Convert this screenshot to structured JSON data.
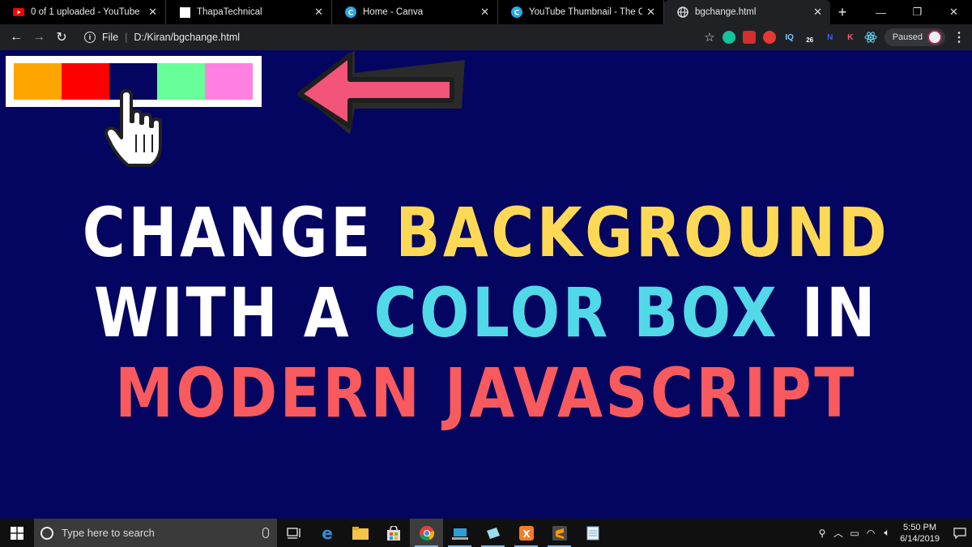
{
  "tabs": [
    {
      "title": "0 of 1 uploaded - YouTube",
      "icon": "youtube-icon"
    },
    {
      "title": "ThapaTechnical",
      "icon": "blank-page-icon"
    },
    {
      "title": "Home - Canva",
      "icon": "canva-icon"
    },
    {
      "title": "YouTube Thumbnail - The Can",
      "icon": "canva-icon"
    },
    {
      "title": "bgchange.html",
      "icon": "globe-icon",
      "active": true
    }
  ],
  "address": {
    "scheme": "File",
    "path": "D:/Kiran/bgchange.html"
  },
  "extensions": [
    {
      "name": "grammarly-icon",
      "color": "#15c39a",
      "label": ""
    },
    {
      "name": "red-square-icon",
      "color": "#d32f2f",
      "label": ""
    },
    {
      "name": "adblock-icon",
      "color": "#e53935",
      "label": ""
    },
    {
      "name": "iq-icon",
      "color": "transparent",
      "label": "IQ"
    },
    {
      "name": "badge-26-icon",
      "color": "transparent",
      "label": "26"
    },
    {
      "name": "n-icon",
      "color": "transparent",
      "label": "N"
    },
    {
      "name": "k-icon",
      "color": "transparent",
      "label": "K"
    },
    {
      "name": "react-icon",
      "color": "transparent",
      "label": ""
    }
  ],
  "profile": {
    "status": "Paused"
  },
  "page": {
    "background": "#040560",
    "swatches": [
      "#ffa500",
      "#ff0000",
      "#040560",
      "#66ff99",
      "#ff80e0"
    ],
    "arrow_color": "#f2547a",
    "headline": {
      "line1": [
        {
          "text": "CHANGE",
          "color": "#ffffff"
        },
        {
          "text": "BACKGROUND",
          "color": "#ffd955"
        }
      ],
      "line2": [
        {
          "text": "WITH A",
          "color": "#ffffff"
        },
        {
          "text": "COLOR BOX",
          "color": "#52d9e8"
        },
        {
          "text": "IN",
          "color": "#ffffff"
        }
      ],
      "line3": [
        {
          "text": "MODERN",
          "color": "#f85a5e"
        },
        {
          "text": "JAVASCRIPT",
          "color": "#f85a5e"
        }
      ]
    }
  },
  "taskbar": {
    "search_placeholder": "Type here to search",
    "apps": [
      "task-view-icon",
      "edge-icon",
      "file-explorer-icon",
      "store-icon",
      "chrome-icon",
      "app-icon",
      "app-icon-2",
      "xampp-icon",
      "sublime-icon",
      "notepad-icon"
    ],
    "time": "5:50 PM",
    "date": "6/14/2019"
  }
}
